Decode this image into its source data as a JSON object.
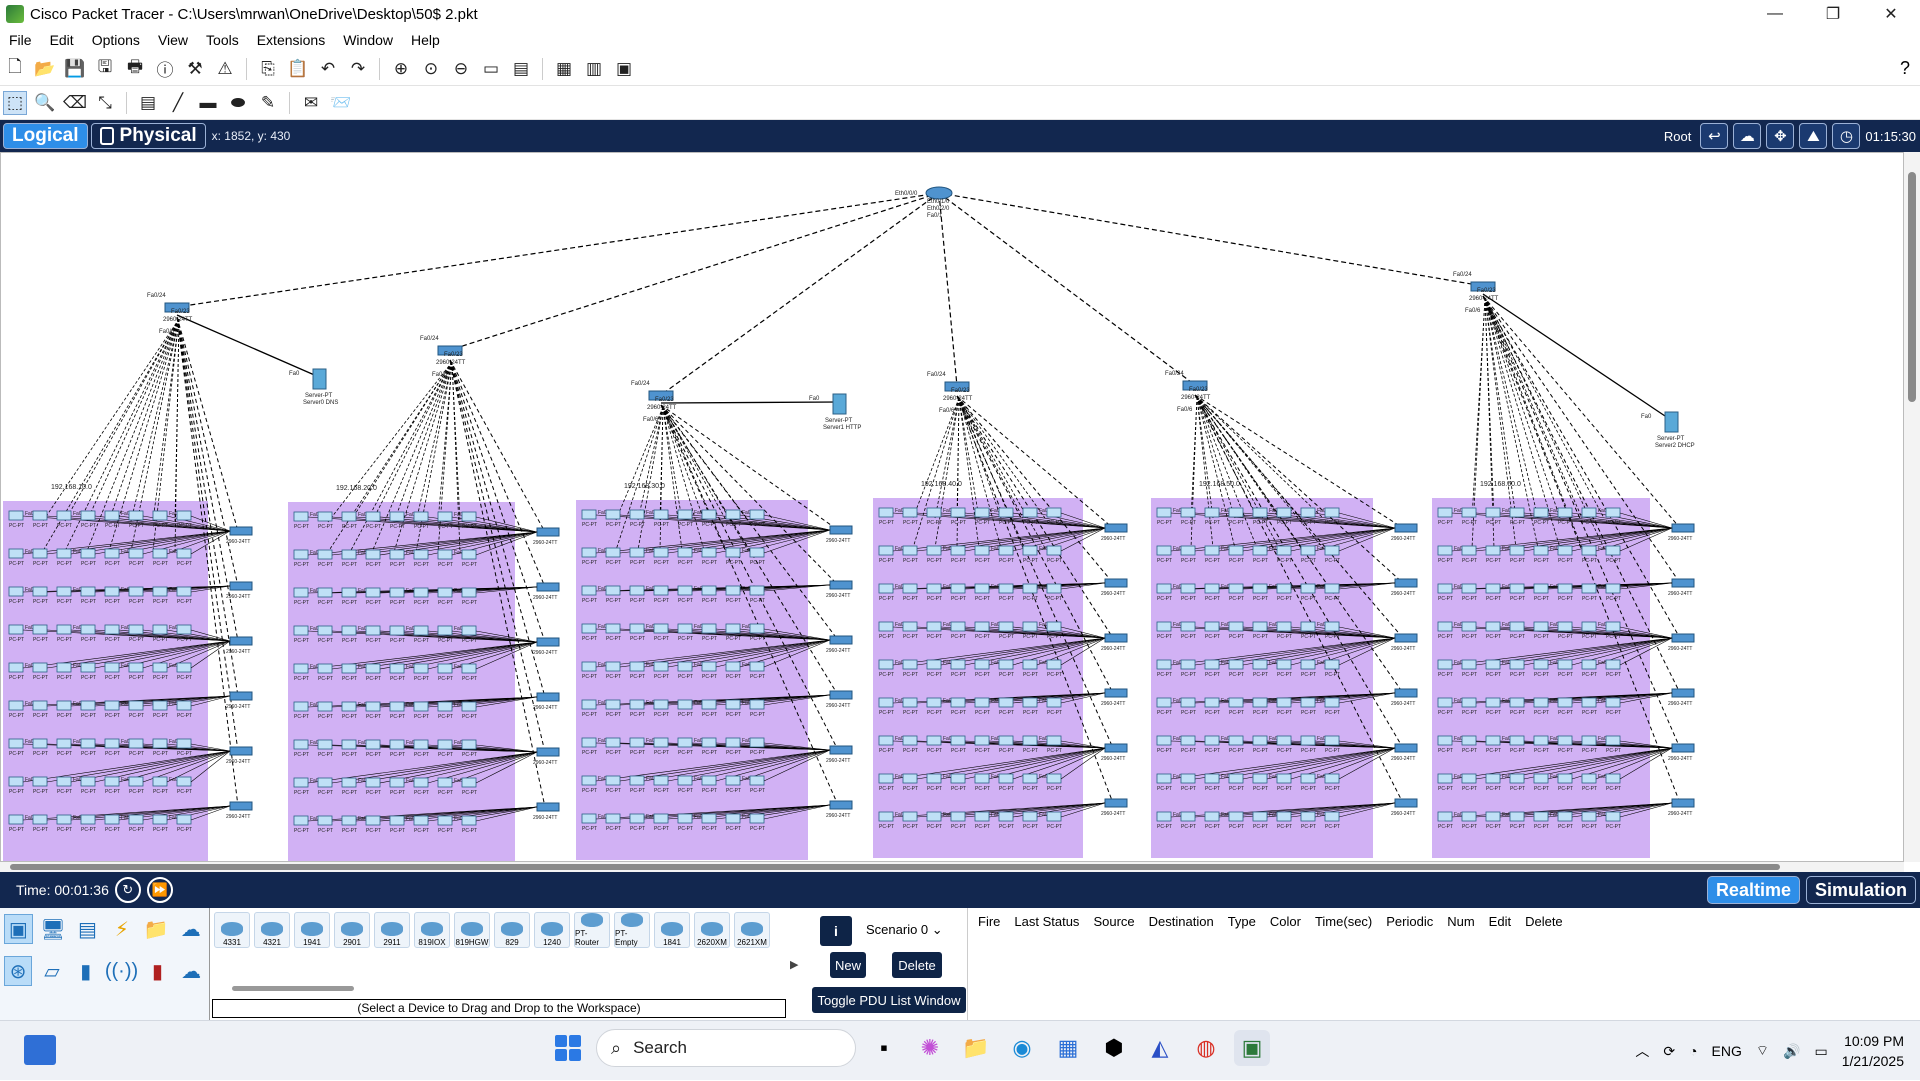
{
  "window": {
    "title": "Cisco Packet Tracer - C:\\Users\\mrwan\\OneDrive\\Desktop\\50$ 2.pkt",
    "minimize": "—",
    "maximize": "❐",
    "close": "✕"
  },
  "menu": [
    "File",
    "Edit",
    "Options",
    "View",
    "Tools",
    "Extensions",
    "Window",
    "Help"
  ],
  "toolbar1": {
    "icons": [
      "new-icon",
      "open-icon",
      "save-icon",
      "save-as-icon",
      "print-icon",
      "info-icon",
      "wizard-icon",
      "network-info-icon",
      "copy-icon",
      "paste-icon",
      "undo-icon",
      "redo-icon",
      "zoom-in-icon",
      "zoom-reset-icon",
      "zoom-out-icon",
      "drawing-palette-icon",
      "custom-device-icon",
      "notes-icon",
      "viewport-icon",
      "screenshot-icon"
    ],
    "help": "?"
  },
  "toolbar2": {
    "icons": [
      "select-icon",
      "inspect-icon",
      "delete-icon",
      "resize-icon",
      "note-icon",
      "line-icon",
      "rectangle-icon",
      "ellipse-icon",
      "freeform-icon",
      "simple-pdu-icon",
      "complex-pdu-icon"
    ]
  },
  "viewbar": {
    "logical": "Logical",
    "physical": "Physical",
    "coords": "x: 1852, y: 430",
    "root": "Root",
    "clock": "01:15:30"
  },
  "topology": {
    "core_router": {
      "ports": [
        "Eth0/0/0",
        "Eth0/1/0",
        "Eth0/2/0",
        "Fa0/1"
      ]
    },
    "servers": [
      {
        "label1": "Server-PT",
        "label2": "Server0 DNS",
        "port": "Fa0"
      },
      {
        "label1": "Server-PT",
        "label2": "Server1 HTTP",
        "port": "Fa0"
      },
      {
        "label1": "Server-PT",
        "label2": "Server2 DHCP",
        "port": "Fa0"
      }
    ],
    "distribution": [
      {
        "label": "2960-24TT",
        "uplink": "Fa0/24",
        "port": "Fa0/23",
        "down": "Fa0/6"
      },
      {
        "label": "2960-24TT",
        "uplink": "Fa0/24",
        "port": "Fa0/23",
        "down": "Fa0/6"
      },
      {
        "label": "2960-24TT",
        "uplink": "Fa0/24",
        "port": "Fa0/23",
        "down": "Fa0/6"
      },
      {
        "label": "2960-24TT",
        "uplink": "Fa0/24",
        "port": "Fa0/23",
        "down": "Fa0/6"
      },
      {
        "label": "2960-24TT",
        "uplink": "Fa0/24",
        "port": "Fa0/23",
        "down": "Fa0/6"
      },
      {
        "label": "2960-24TT",
        "uplink": "Fa0/24",
        "port": "Fa0/23",
        "down": "Fa0/6"
      }
    ],
    "networks": [
      "192.168.10.0",
      "192.168.20.0",
      "192.168.30.0",
      "192.168.40.0",
      "192.168.50.0",
      "192.168.60.0"
    ],
    "access_switch_label": "2960-24TT",
    "pc_label": "PC-PT",
    "port_label": "Fa0"
  },
  "timebar": {
    "time": "Time: 00:01:36",
    "realtime": "Realtime",
    "simulation": "Simulation"
  },
  "device_categories": {
    "row1": [
      "network-devices-icon",
      "end-devices-icon",
      "components-icon",
      "connections-icon",
      "misc-icon",
      "multiuser-icon"
    ],
    "row2": [
      "routers-icon",
      "switches-icon",
      "hubs-icon",
      "wireless-icon",
      "security-icon",
      "wan-emulation-icon"
    ]
  },
  "devices": [
    "4331",
    "4321",
    "1941",
    "2901",
    "2911",
    "819IOX",
    "819HGW",
    "829",
    "1240",
    "PT-Router",
    "PT-Empty",
    "1841",
    "2620XM",
    "2621XM"
  ],
  "device_hint": "(Select a Device to Drag and Drop to the Workspace)",
  "scenario": {
    "info": "i",
    "select": "Scenario 0",
    "new": "New",
    "delete": "Delete",
    "toggle": "Toggle PDU List Window"
  },
  "pdu_columns": [
    "Fire",
    "Last Status",
    "Source",
    "Destination",
    "Type",
    "Color",
    "Time(sec)",
    "Periodic",
    "Num",
    "Edit",
    "Delete"
  ],
  "taskbar": {
    "search": "Search",
    "lang": "ENG",
    "time": "10:09 PM",
    "date": "1/21/2025"
  },
  "colors": {
    "navbar": "#12274f",
    "accent": "#2e8ee8",
    "cluster": "#c9a3f2",
    "link": "#000000"
  }
}
